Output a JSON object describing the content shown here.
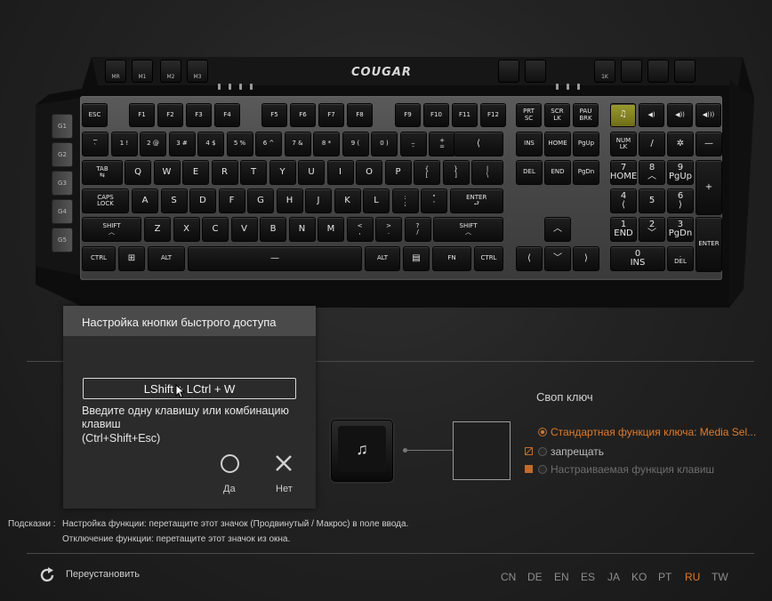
{
  "keyboard": {
    "brand": "COUGAR",
    "macro_keys": [
      "MR",
      "M1",
      "M2",
      "M3"
    ],
    "media_top_keys": [
      "1K"
    ],
    "g_keys": [
      "G1",
      "G2",
      "G3",
      "G4",
      "G5"
    ],
    "rows": [
      [
        "ESC",
        "F1",
        "F2",
        "F3",
        "F4",
        "F5",
        "F6",
        "F7",
        "F8",
        "F9",
        "F10",
        "F11",
        "F12",
        "PRT\nSC",
        "SCR\nLK",
        "PAU\nBRK"
      ],
      [
        "~\n`",
        "1 !",
        "2 @",
        "3 #",
        "4 $",
        "5 %",
        "6 ^",
        "7 &",
        "8 *",
        "9 (",
        "0 )",
        "_\n-",
        "+\n=",
        "⟨",
        "INS",
        "HOME",
        "PgUp",
        "NUM\nLK",
        "/",
        "✲",
        "—"
      ],
      [
        "TAB\n⇆",
        "Q",
        "W",
        "E",
        "R",
        "T",
        "Y",
        "U",
        "I",
        "O",
        "P",
        "{\n[",
        "}\n]",
        "|\n\\",
        "DEL",
        "END",
        "PgDn",
        "7\nHOME",
        "8\n︿",
        "9\nPgUp",
        "+"
      ],
      [
        "CAPS\nLOCK",
        "A",
        "S",
        "D",
        "F",
        "G",
        "H",
        "J",
        "K",
        "L",
        ":\n;",
        "\"\n'",
        "ENTER\n⮐",
        "4\n⟨",
        "5",
        "6\n⟩"
      ],
      [
        "SHIFT\n︿",
        "Z",
        "X",
        "C",
        "V",
        "B",
        "N",
        "M",
        "<\n,",
        ">\n.",
        "?\n/",
        "SHIFT\n︿",
        "︿",
        "1\nEND",
        "2\n﹀",
        "3\nPgDn",
        "ENTER"
      ],
      [
        "CTRL",
        "⊞",
        "ALT",
        "—",
        "ALT",
        "▤",
        "FN",
        "CTRL",
        "⟨",
        "﹀",
        "⟩",
        "0\nINS",
        ".\nDEL"
      ]
    ],
    "media_keys": [
      "♫",
      "◀)",
      "◀))",
      "◀)))"
    ]
  },
  "popup": {
    "title": "Настройка кнопки быстрого доступа",
    "input_value": "LShift + LCtrl + W",
    "hint": "Введите одну клавишу или комбинацию клавиш\n(Ctrl+Shift+Esc)",
    "confirm_label": "Да",
    "cancel_label": "Нет"
  },
  "swap": {
    "title": "Своп ключ",
    "preview_symbol": "♫",
    "options": [
      {
        "label": "Стандартная функция ключа: Media Sel...",
        "selected": true
      },
      {
        "label": "запрещать",
        "selected": false
      },
      {
        "label": "Настраиваемая функция клавиш",
        "selected": false
      }
    ]
  },
  "tips": {
    "prefix": "Подсказки :",
    "line1": "Настройка функции: перетащите этот значок (Продвинутый / Макрос) в поле ввода.",
    "line2": "Отключение функции: перетащите этот значок из окна."
  },
  "footer": {
    "reset_label": "Переустановить",
    "languages": [
      "CN",
      "DE",
      "EN",
      "ES",
      "JA",
      "KO",
      "PT",
      "RU",
      "TW"
    ],
    "selected_language": "RU"
  },
  "colors": {
    "accent": "#e07b2b",
    "background": "#232323",
    "popup": "#2b2b2b",
    "popup_header": "#4a4a4a"
  }
}
